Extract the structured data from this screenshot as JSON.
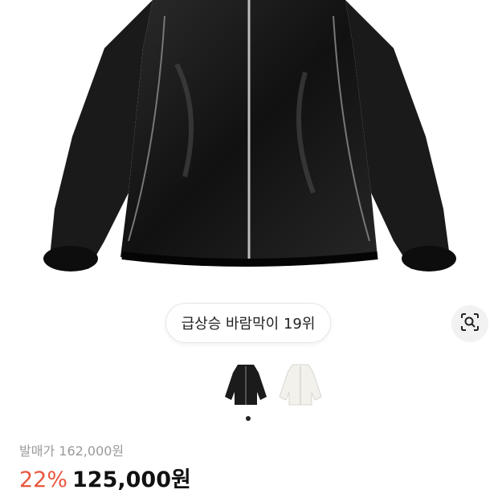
{
  "product": {
    "image_name": "black-windbreaker-jacket",
    "rank_chip": "급상승 바람막이 19위",
    "lens_icon": "visual-search-icon",
    "color_options": [
      "black",
      "white"
    ],
    "selected_option_index": 0,
    "list_price_label": "발매가",
    "list_price_value": "162,000원",
    "discount": "22%",
    "sale_price": "125,000원"
  },
  "colors": {
    "discount": "#e8573e",
    "text": "#111111",
    "muted": "#9a9a9a"
  }
}
